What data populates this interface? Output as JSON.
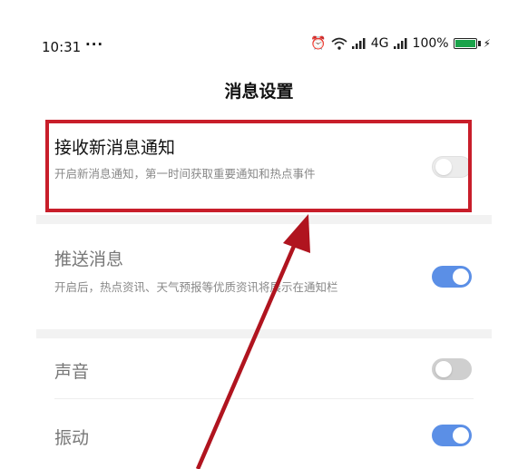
{
  "status_bar": {
    "time": "10:31",
    "dots": "···",
    "network": "4G",
    "battery": "100%"
  },
  "page": {
    "title": "消息设置"
  },
  "settings": [
    {
      "title": "接收新消息通知",
      "description": "开启新消息通知，第一时间获取重要通知和热点事件",
      "toggle_state": "off"
    },
    {
      "title": "推送消息",
      "description": "开启后，热点资讯、天气预报等优质资讯将展示在通知栏",
      "toggle_state": "on"
    },
    {
      "title": "声音",
      "toggle_state": "off"
    },
    {
      "title": "振动",
      "toggle_state": "on"
    }
  ],
  "colors": {
    "accent": "#5b8fe6",
    "highlight": "#c81e2a",
    "battery": "#1aa34a"
  }
}
